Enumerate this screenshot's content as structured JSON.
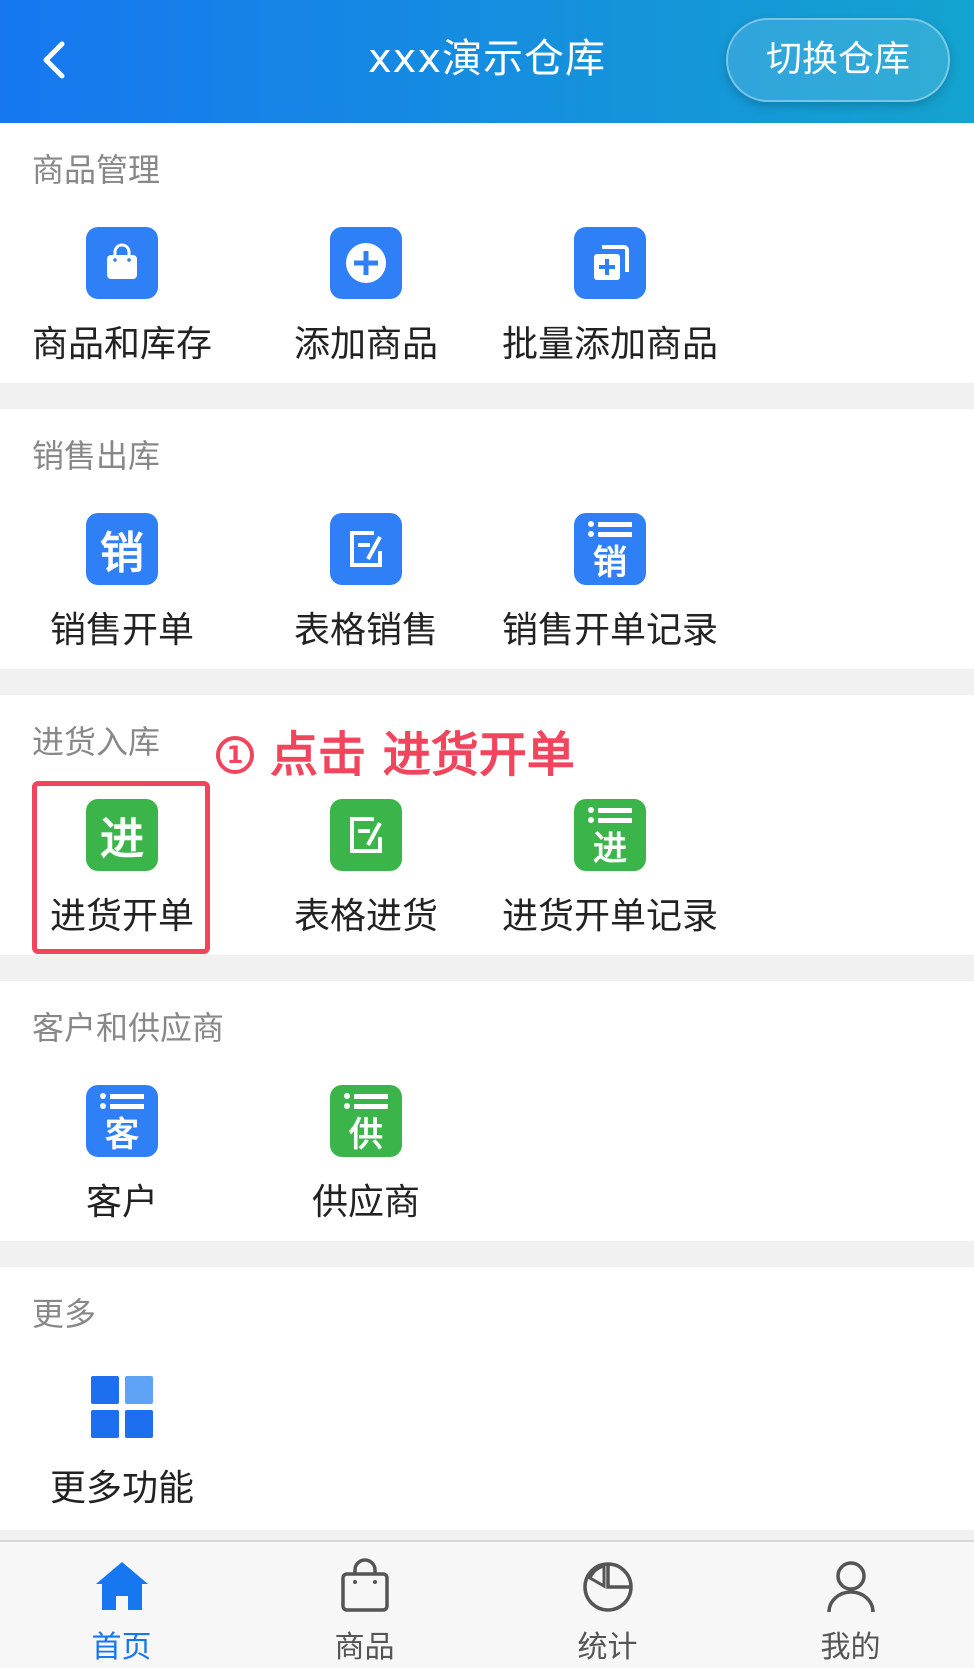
{
  "header": {
    "title": "xxx演示仓库",
    "switch_label": "切换仓库"
  },
  "sections": {
    "goods": {
      "title": "商品管理",
      "items": [
        "商品和库存",
        "添加商品",
        "批量添加商品"
      ]
    },
    "sales": {
      "title": "销售出库",
      "items": [
        "销售开单",
        "表格销售",
        "销售开单记录"
      ],
      "icon_chars": [
        "销",
        "销"
      ]
    },
    "purchase": {
      "title": "进货入库",
      "items": [
        "进货开单",
        "表格进货",
        "进货开单记录"
      ],
      "icon_chars": [
        "进",
        "进"
      ]
    },
    "partners": {
      "title": "客户和供应商",
      "items": [
        "客户",
        "供应商"
      ],
      "icon_chars": [
        "客",
        "供"
      ]
    },
    "more": {
      "title": "更多",
      "items": [
        "更多功能"
      ]
    }
  },
  "annotation": {
    "number": "1",
    "text": "点击 进货开单"
  },
  "tabbar": {
    "items": [
      "首页",
      "商品",
      "统计",
      "我的"
    ],
    "active": "首页"
  },
  "colors": {
    "header_start": "#1677f0",
    "header_end": "#14a3cf",
    "icon_blue": "#2f7ff6",
    "icon_green": "#3bb54a",
    "annotation_red": "#f0455d",
    "tab_active": "#1677f0"
  },
  "icons": {
    "back": "chevron-left-icon",
    "goods_inventory": "shopping-bag-icon",
    "add_goods": "plus-circle-icon",
    "batch_add": "copy-plus-icon",
    "table_sales": "edit-table-icon",
    "table_purchase": "edit-table-icon",
    "more": "grid-icon",
    "tab_home": "home-icon",
    "tab_goods": "bag-icon",
    "tab_stats": "pie-chart-icon",
    "tab_mine": "user-icon"
  }
}
